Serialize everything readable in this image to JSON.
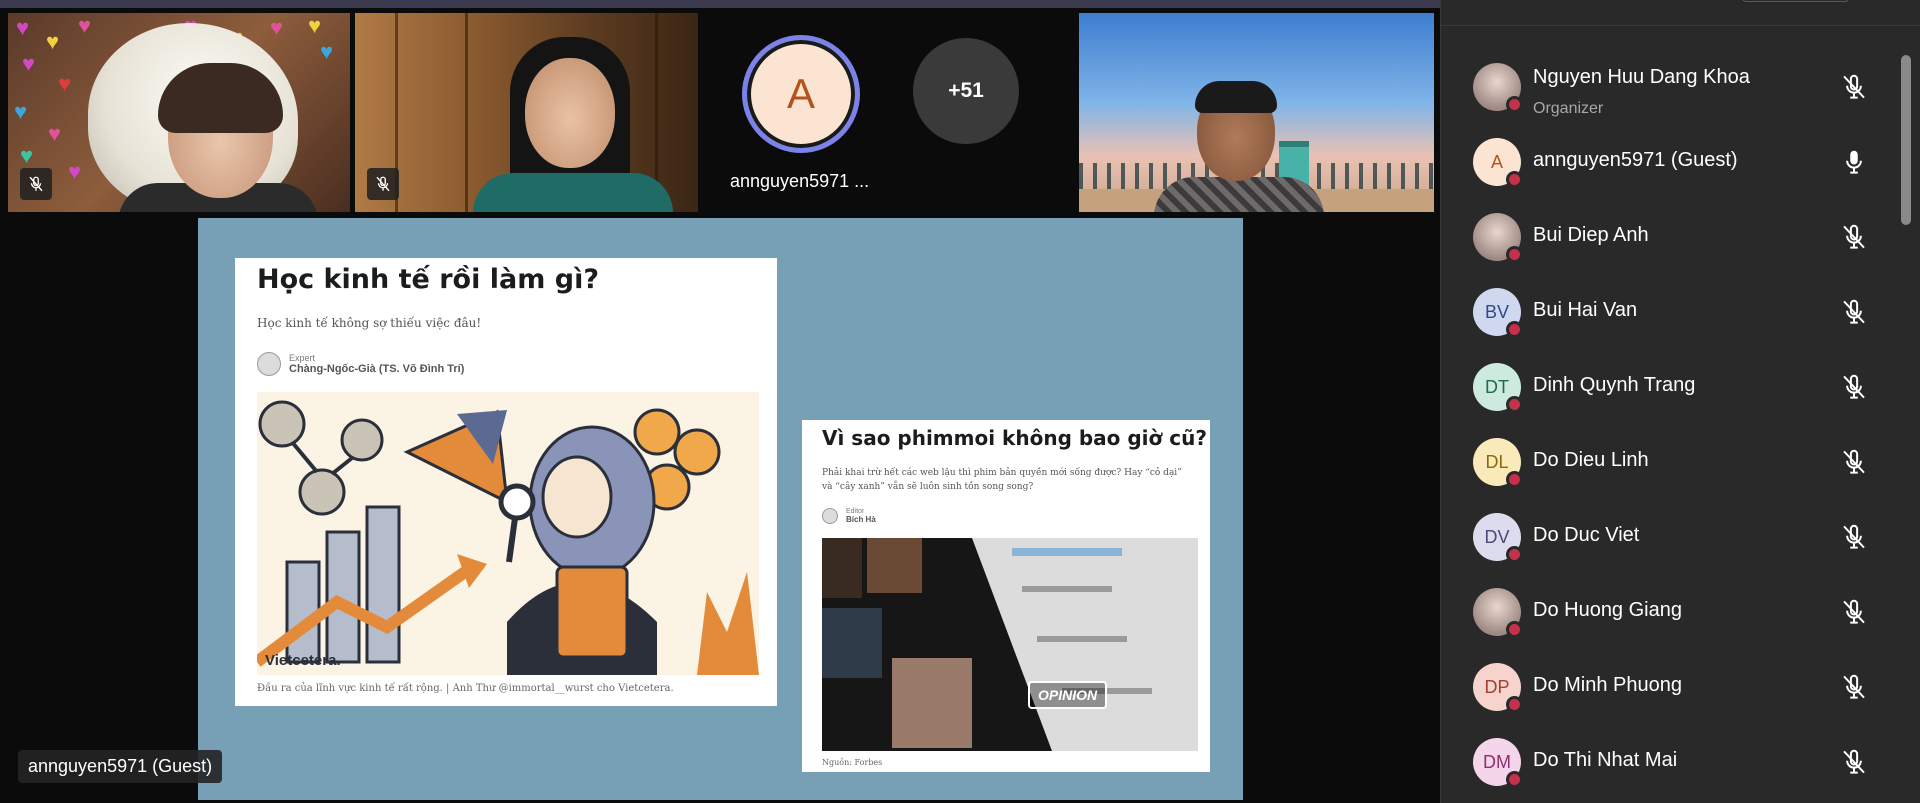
{
  "colors": {
    "stage_bg": "#0b0b0b",
    "sidebar_bg": "#292929",
    "accent": "#7b83eb",
    "busy_red": "#c4314b",
    "slide_bg": "#779fb6"
  },
  "video_strip": {
    "avatar_tile": {
      "initial": "A",
      "name": "annguyen5971 ..."
    },
    "overflow": {
      "label": "+51"
    }
  },
  "shared_screen": {
    "card1": {
      "title": "Học kinh tế rồi làm gì?",
      "subtitle": "Học kinh tế không sợ thiếu việc đâu!",
      "author_role": "Expert",
      "author_name": "Chàng-Ngốc-Già (TS. Võ Đình Trí)",
      "illustration_brand": "Vietcetera.",
      "caption": "Đầu ra của lĩnh vực kinh tế rất rộng. | Anh Thư @immortal__wurst cho Vietcetera."
    },
    "card2": {
      "title": "Vì sao phimmoi không bao giờ cũ?",
      "subtitle": "Phải khai trừ hết các web lậu thì phim bản quyền mới sống được? Hay “cỏ dại” và “cây xanh” vẫn sẽ luôn sinh tồn song song?",
      "author_role": "Editor",
      "author_name": "Bích Hà",
      "badge": "OPINION",
      "caption": "Nguồn: Forbes"
    }
  },
  "stage_label": "annguyen5971 (Guest)",
  "participants": [
    {
      "name": "Nguyen Huu Dang Khoa",
      "role": "Organizer",
      "initials": "",
      "avatar_bg": "photo",
      "text_color": "#fff",
      "mic": "muted"
    },
    {
      "name": "annguyen5971 (Guest)",
      "role": "",
      "initials": "A",
      "avatar_bg": "#fbe5d2",
      "text_color": "#b3531c",
      "mic": "on"
    },
    {
      "name": "Bui Diep Anh",
      "role": "",
      "initials": "",
      "avatar_bg": "photo",
      "text_color": "#fff",
      "mic": "muted"
    },
    {
      "name": "Bui Hai Van",
      "role": "",
      "initials": "BV",
      "avatar_bg": "#cfd8ef",
      "text_color": "#2f4a8a",
      "mic": "muted"
    },
    {
      "name": "Dinh Quynh Trang",
      "role": "",
      "initials": "DT",
      "avatar_bg": "#cdeadf",
      "text_color": "#1f6b4e",
      "mic": "muted"
    },
    {
      "name": "Do Dieu Linh",
      "role": "",
      "initials": "DL",
      "avatar_bg": "#fbeab9",
      "text_color": "#8a6a0d",
      "mic": "muted"
    },
    {
      "name": "Do Duc Viet",
      "role": "",
      "initials": "DV",
      "avatar_bg": "#dcdcee",
      "text_color": "#4a4a7a",
      "mic": "muted"
    },
    {
      "name": "Do Huong Giang",
      "role": "",
      "initials": "",
      "avatar_bg": "photo",
      "text_color": "#fff",
      "mic": "muted"
    },
    {
      "name": "Do Minh Phuong",
      "role": "",
      "initials": "DP",
      "avatar_bg": "#f6d3cc",
      "text_color": "#a3402f",
      "mic": "muted"
    },
    {
      "name": "Do Thi Nhat Mai",
      "role": "",
      "initials": "DM",
      "avatar_bg": "#f4d5ea",
      "text_color": "#8f2f70",
      "mic": "muted"
    }
  ]
}
